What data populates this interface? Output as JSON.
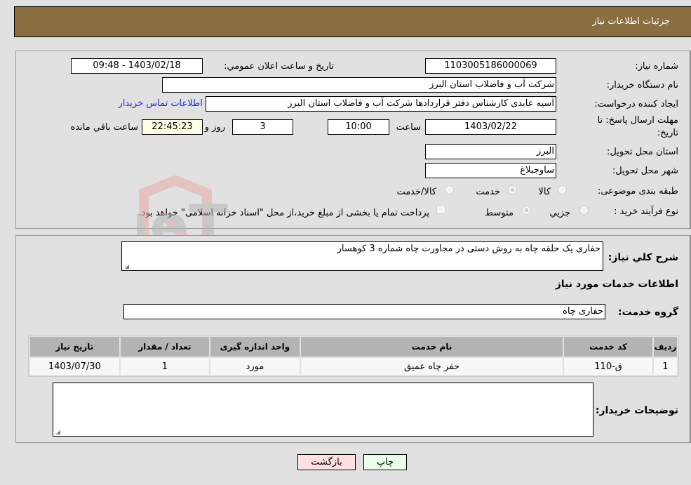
{
  "header": {
    "title": "جزئیات اطلاعات نیاز"
  },
  "form": {
    "need_number": {
      "label": "شماره نیاز:",
      "value": "1103005186000069"
    },
    "announce_datetime": {
      "label": "تاریخ و ساعت اعلان عمومي:",
      "value": "1403/02/18 - 09:48"
    },
    "buyer_org": {
      "label": "نام دستگاه خریدار:",
      "value": "شرکت آب و فاضلاب استان البرز"
    },
    "requester": {
      "label": "ایجاد کننده درخواست:",
      "value": "آسیه عابدی کارشناس دفتر قراردادها شرکت آب و فاضلاب استان البرز"
    },
    "contact_link": "اطلاعات تماس خریدار",
    "deadline": {
      "label_line1": "مهلت ارسال پاسخ: تا",
      "label_line2": "تاریخ:",
      "date": "1403/02/22",
      "time_label": "ساعت",
      "time": "10:00",
      "days": "3",
      "days_label": "روز و",
      "remaining": "22:45:23",
      "remaining_label": "ساعت باقي مانده"
    },
    "province": {
      "label": "استان محل تحویل:",
      "value": "البرز"
    },
    "city": {
      "label": "شهر محل تحویل:",
      "value": "ساوجبلاغ"
    },
    "category": {
      "label": "طبقه بندی موضوعی:",
      "options": [
        "کالا",
        "خدمت",
        "کالا/خدمت"
      ],
      "selected": "خدمت"
    },
    "purchase_type": {
      "label": "نوع فرآیند خرید :",
      "options": [
        "جزيي",
        "متوسط"
      ],
      "selected": "متوسط",
      "treasury_note": "پرداخت تمام یا بخشی از مبلغ خرید،از محل \"اسناد خزانه اسلامی\" خواهد بود."
    }
  },
  "details": {
    "description_label": "شرح كلي نیاز:",
    "description": "حفاری یک حلقه چاه به روش دستی در مجاورت چاه شماره 3 کوهسار",
    "services_heading": "اطلاعات خدمات مورد نیاز",
    "service_group_label": "گروه خدمت:",
    "service_group": "حفاری چاه",
    "table": {
      "headers": [
        "ردیف",
        "کد خدمت",
        "نام خدمت",
        "واحد اندازه گیری",
        "تعداد / مقدار",
        "تاریخ نیاز"
      ],
      "rows": [
        [
          "1",
          "ق-110",
          "حفر چاه عمیق",
          "مورد",
          "1",
          "1403/07/30"
        ]
      ]
    },
    "buyer_notes_label": "توضیحات خریدار:",
    "buyer_notes": ""
  },
  "buttons": {
    "print": "چاپ",
    "back": "بازگشت"
  },
  "watermark": {
    "text": "AriaTender.neT"
  }
}
